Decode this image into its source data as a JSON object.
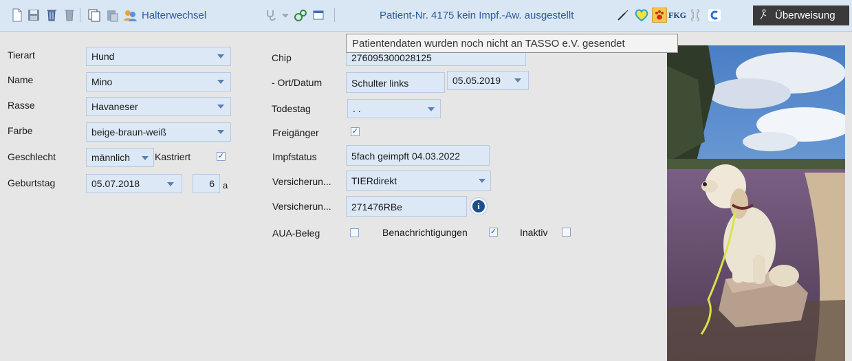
{
  "toolbar": {
    "halterwechsel_label": "Halterwechsel",
    "status_text": "Patient-Nr. 4175 kein Impf.-Aw. ausgestellt",
    "fkg_label": "FKG",
    "ueberweisung_label": "Überweisung"
  },
  "tooltip": {
    "text": "Patientendaten wurden noch nicht an TASSO e.V. gesendet"
  },
  "form_left": {
    "tierart": {
      "label": "Tierart",
      "value": "Hund"
    },
    "name": {
      "label": "Name",
      "value": "Mino"
    },
    "rasse": {
      "label": "Rasse",
      "value": "Havaneser"
    },
    "farbe": {
      "label": "Farbe",
      "value": "beige-braun-weiß"
    },
    "geschlecht": {
      "label": "Geschlecht",
      "value": "männlich",
      "kastriert_label": "Kastriert",
      "kastriert_checked": true
    },
    "geburtstag": {
      "label": "Geburtstag",
      "value": "05.07.2018",
      "age": "6",
      "age_unit": "a"
    }
  },
  "form_right": {
    "chip": {
      "label": "Chip",
      "value": "276095300028125"
    },
    "ort_datum": {
      "label": "- Ort/Datum",
      "ort": "Schulter links",
      "datum": "05.05.2019"
    },
    "todestag": {
      "label": "Todestag",
      "value": " .  ."
    },
    "freigaenger": {
      "label": "Freigänger",
      "checked": true
    },
    "impfstatus": {
      "label": "Impfstatus",
      "value": "5fach geimpft 04.03.2022"
    },
    "versicherung": {
      "label": "Versicherun...",
      "value": "TIERdirekt"
    },
    "versicherungsnr": {
      "label": "Versicherun...",
      "value": "271476RBe"
    },
    "aua_beleg": {
      "label": "AUA-Beleg",
      "checked": false
    },
    "benachrichtigungen": {
      "label": "Benachrichtigungen",
      "checked": true
    },
    "inaktiv": {
      "label": "Inaktiv",
      "checked": false
    }
  },
  "colors": {
    "toolbar_bg": "#d9e6f4",
    "field_bg": "#dce8f6",
    "accent_text": "#2e5b9a",
    "window_bg": "#e6e6e6"
  }
}
